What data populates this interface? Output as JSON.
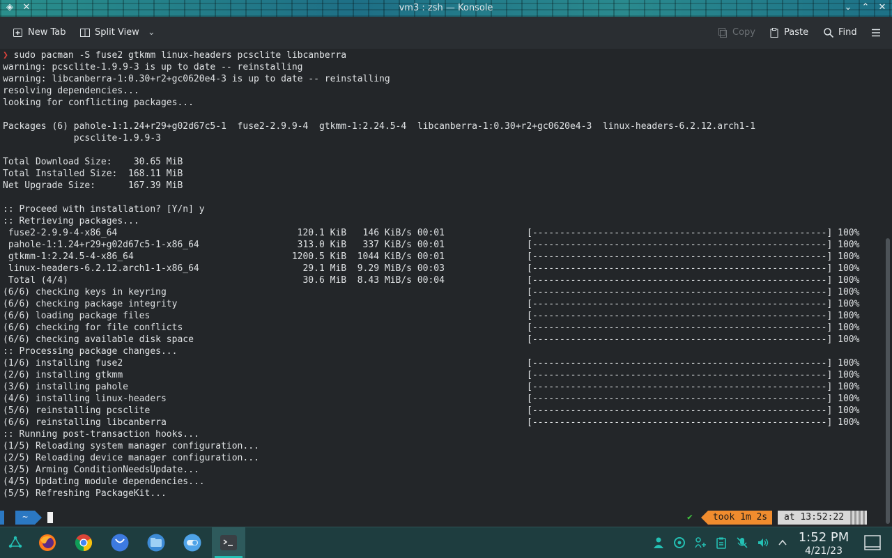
{
  "window": {
    "title": "vm3 : zsh — Konsole"
  },
  "toolbar": {
    "new_tab": "New Tab",
    "split_view": "Split View",
    "copy": "Copy",
    "paste": "Paste",
    "find": "Find"
  },
  "terminal": {
    "command_prompt": "❯",
    "command": "sudo pacman -S fuse2 gtkmm linux-headers pcsclite libcanberra",
    "lines": [
      "warning: pcsclite-1.9.9-3 is up to date -- reinstalling",
      "warning: libcanberra-1:0.30+r2+gc0620e4-3 is up to date -- reinstalling",
      "resolving dependencies...",
      "looking for conflicting packages...",
      "",
      "Packages (6) pahole-1:1.24+r29+g02d67c5-1  fuse2-2.9.9-4  gtkmm-1:2.24.5-4  libcanberra-1:0.30+r2+gc0620e4-3  linux-headers-6.2.12.arch1-1",
      "             pcsclite-1.9.9-3",
      "",
      "Total Download Size:    30.65 MiB",
      "Total Installed Size:  168.11 MiB",
      "Net Upgrade Size:      167.39 MiB",
      "",
      ":: Proceed with installation? [Y/n] y",
      ":: Retrieving packages...",
      " fuse2-2.9.9-4-x86_64                                 120.1 KiB   146 KiB/s 00:01",
      " pahole-1:1.24+r29+g02d67c5-1-x86_64                  313.0 KiB   337 KiB/s 00:01",
      " gtkmm-1:2.24.5-4-x86_64                             1200.5 KiB  1044 KiB/s 00:01",
      " linux-headers-6.2.12.arch1-1-x86_64                   29.1 MiB  9.29 MiB/s 00:03",
      " Total (4/4)                                           30.6 MiB  8.43 MiB/s 00:04",
      "(6/6) checking keys in keyring",
      "(6/6) checking package integrity",
      "(6/6) loading package files",
      "(6/6) checking for file conflicts",
      "(6/6) checking available disk space",
      ":: Processing package changes...",
      "(1/6) installing fuse2",
      "(2/6) installing gtkmm",
      "(3/6) installing pahole",
      "(4/6) installing linux-headers",
      "(5/6) reinstalling pcsclite",
      "(6/6) reinstalling libcanberra",
      ":: Running post-transaction hooks...",
      "(1/5) Reloading system manager configuration...",
      "(2/5) Reloading device manager configuration...",
      "(3/5) Arming ConditionNeedsUpdate...",
      "(4/5) Updating module dependencies...",
      "(5/5) Refreshing PackageKit..."
    ],
    "progress_bar": "[------------------------------------------------------] 100%",
    "progress_rows": [
      "fuse2",
      "pahole",
      "gtkmm",
      "linux-headers",
      "total",
      "keys",
      "integrity",
      "files",
      "conflicts",
      "disk",
      "fuse2-install",
      "gtkmm-install",
      "pahole-install",
      "linux-headers-install",
      "pcsclite",
      "libcanberra"
    ]
  },
  "prompt": {
    "dir": "~",
    "check": "✔",
    "took": "took 1m 2s",
    "at": "at 13:52:22"
  },
  "taskbar": {
    "clock_time": "1:52 PM",
    "clock_date": "4/21/23",
    "apps": [
      "app-launcher",
      "firefox",
      "chrome",
      "ubuntu-app",
      "file-manager",
      "toggle-app",
      "konsole"
    ]
  },
  "colors": {
    "accent": "#24c0b4",
    "prompt_arrow": "#e0433c",
    "prompt_blue": "#2b78c2",
    "took_orange": "#f08c2e",
    "at_gray": "#d8d8d8"
  }
}
